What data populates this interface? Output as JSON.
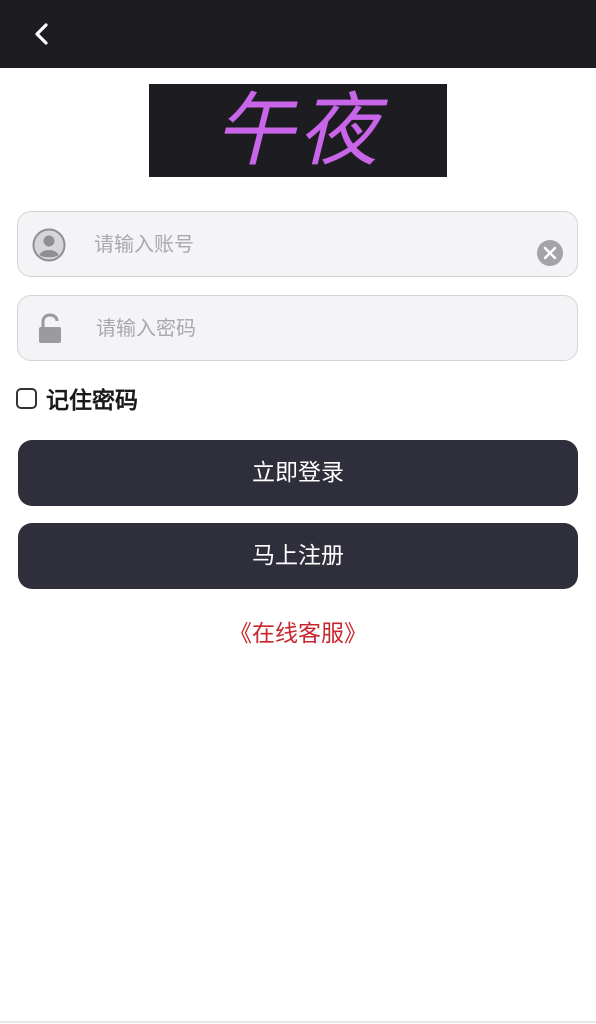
{
  "header": {
    "back_icon": "chevron-left-icon"
  },
  "logo": {
    "text": "午夜",
    "text_color": "#c865e8",
    "background": "#1d1d21"
  },
  "form": {
    "account": {
      "placeholder": "请输入账号",
      "value": "",
      "leading_icon": "user-circle-icon",
      "trailing_icon": "clear-icon"
    },
    "password": {
      "placeholder": "请输入密码",
      "value": "",
      "leading_icon": "lock-open-icon"
    },
    "remember": {
      "label": "记住密码",
      "checked": false
    }
  },
  "actions": {
    "login_label": "立即登录",
    "register_label": "马上注册",
    "service_link": "《在线客服》"
  },
  "colors": {
    "button_bg": "#2e2f3a",
    "link_color": "#c8262c"
  }
}
